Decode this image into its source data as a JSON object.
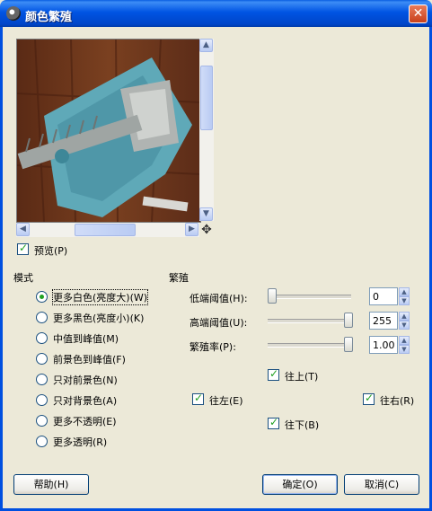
{
  "window": {
    "title": "颜色繁殖"
  },
  "preview": {
    "checkbox_label": "预览(P)",
    "checked": true
  },
  "mode": {
    "heading": "模式",
    "options": [
      {
        "label": "更多白色(亮度大)(W)",
        "selected": true
      },
      {
        "label": "更多黑色(亮度小)(K)",
        "selected": false
      },
      {
        "label": "中值到峰值(M)",
        "selected": false
      },
      {
        "label": "前景色到峰值(F)",
        "selected": false
      },
      {
        "label": "只对前景色(N)",
        "selected": false
      },
      {
        "label": "只对背景色(A)",
        "selected": false
      },
      {
        "label": "更多不透明(E)",
        "selected": false
      },
      {
        "label": "更多透明(R)",
        "selected": false
      }
    ]
  },
  "propagate": {
    "heading": "繁殖",
    "lower_threshold": {
      "label": "低端阈值(H):",
      "value": "0",
      "level": 0
    },
    "upper_threshold": {
      "label": "高端阈值(U):",
      "value": "255",
      "level": 1
    },
    "rate": {
      "label": "繁殖率(P):",
      "value": "1.00",
      "level": 1
    },
    "directions": {
      "up": {
        "label": "往上(T)",
        "checked": true
      },
      "left": {
        "label": "往左(E)",
        "checked": true
      },
      "right": {
        "label": "往右(R)",
        "checked": true
      },
      "down": {
        "label": "往下(B)",
        "checked": true
      }
    }
  },
  "buttons": {
    "help": "帮助(H)",
    "ok": "确定(O)",
    "cancel": "取消(C)"
  },
  "colors": {
    "titlebar": "#0054e3",
    "dialog_bg": "#ece9d8",
    "check_green": "#21a121"
  }
}
